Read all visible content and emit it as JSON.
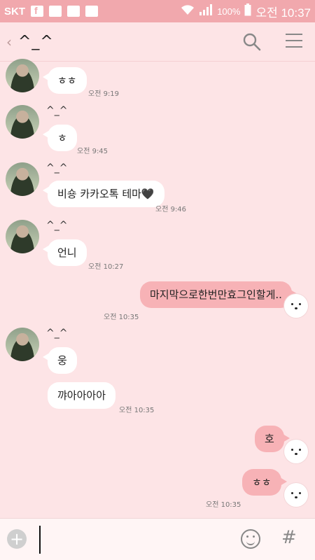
{
  "status_bar": {
    "carrier": "SKT",
    "battery": "100%",
    "clock": "오전 10:37"
  },
  "header": {
    "back_glyph": "‹",
    "title": "^_^"
  },
  "messages": [
    {
      "side": "left",
      "text": "ㅎㅎ",
      "time": "오전 9:19"
    },
    {
      "side": "left",
      "sender": "^_^",
      "text": "ㅎ",
      "time": "오전 9:45"
    },
    {
      "side": "left",
      "sender": "^_^",
      "text": "비숑 카카오톡 테마🖤",
      "time": "오전 9:46"
    },
    {
      "side": "left",
      "sender": "^_^",
      "text": "언니",
      "time": "오전 10:27"
    },
    {
      "side": "right",
      "text": "마지막으로한번만효그인할게..",
      "time": "오전 10:35"
    },
    {
      "side": "left",
      "sender": "^_^",
      "text": "웅",
      "time": ""
    },
    {
      "side": "left",
      "text": "꺄아아아아",
      "time": "오전 10:35"
    },
    {
      "side": "right",
      "text": "호",
      "time": ""
    },
    {
      "side": "right",
      "text": "ㅎㅎ",
      "time": "오전 10:35"
    }
  ],
  "input": {
    "add_glyph": "+",
    "placeholder": "",
    "hash_glyph": "#"
  },
  "colors": {
    "background": "#fde4e6",
    "status_bar": "#f1a8ad",
    "my_bubble": "#f7b2b6",
    "their_bubble": "#ffffff"
  }
}
